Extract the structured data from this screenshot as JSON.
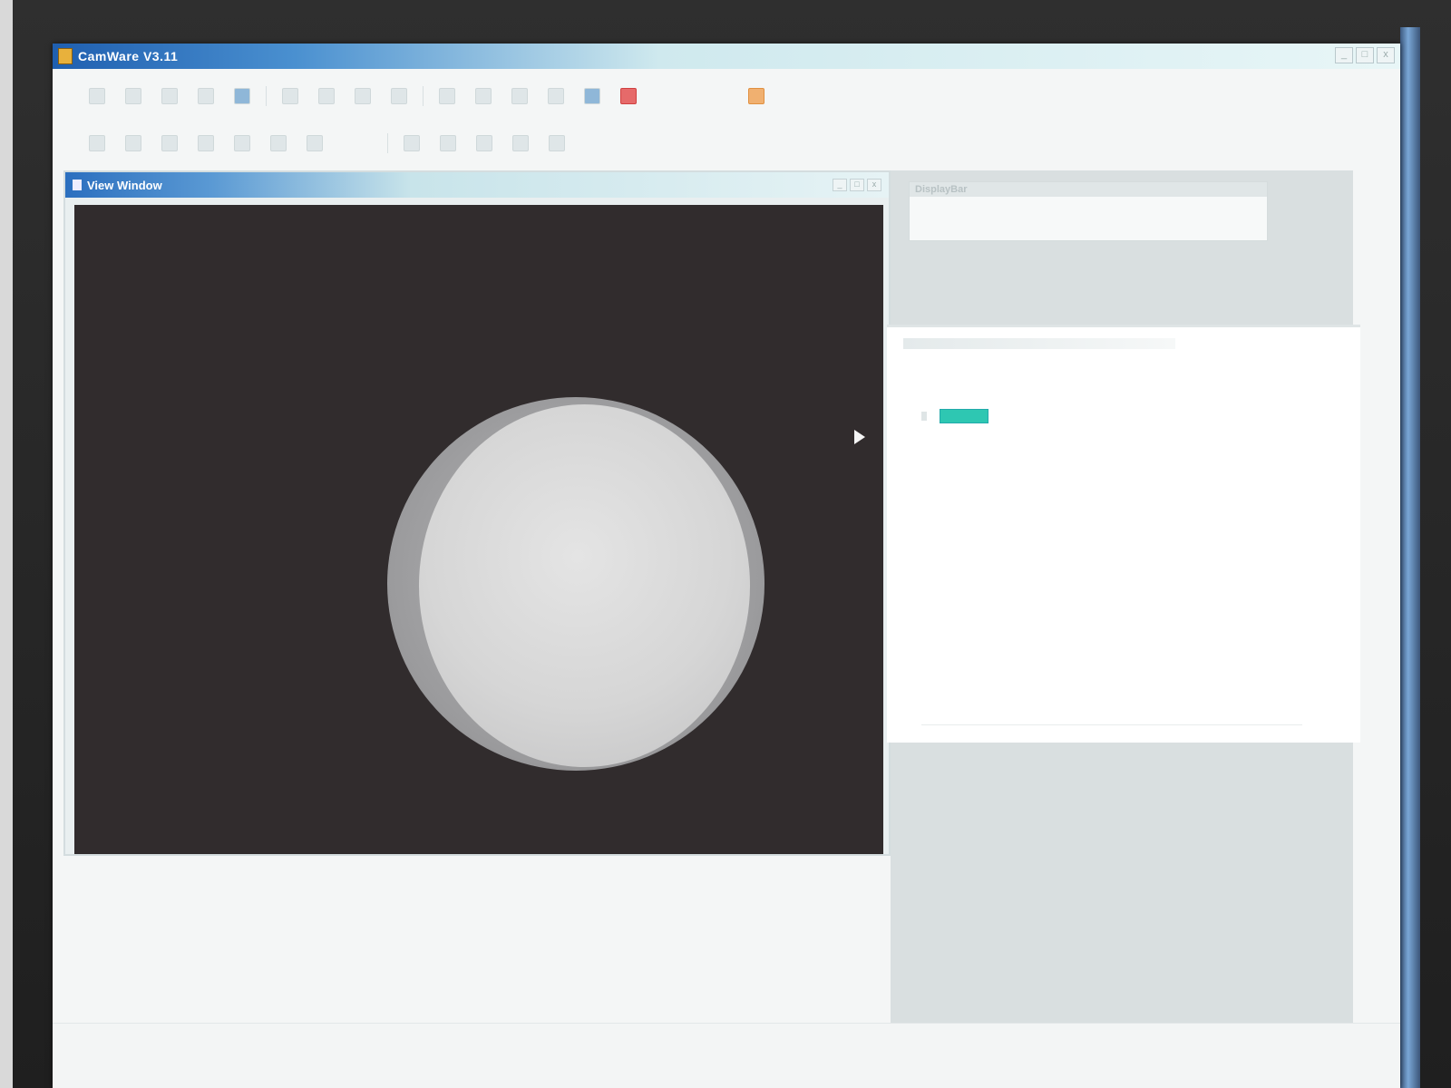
{
  "app": {
    "title": "CamWare V3.11",
    "controls": [
      "_",
      "□",
      "x"
    ]
  },
  "toolbar_top": {
    "text_fields": [
      "",
      ""
    ]
  },
  "view_window": {
    "title": "View Window",
    "controls": [
      "_",
      "□",
      "x"
    ]
  },
  "display_panel": {
    "title": "DisplayBar",
    "items": [
      "",
      "",
      "",
      "",
      ""
    ]
  },
  "properties_panel": {
    "swatch_color": "#2ec7b2",
    "rows": [
      "",
      "",
      "",
      "",
      "",
      "",
      "",
      "",
      ""
    ]
  },
  "status_bar": {
    "items": [
      "",
      "",
      "",
      ""
    ]
  },
  "colors": {
    "titlebar_start": "#1f5fb0",
    "image_background": "#312c2d",
    "disc": "#d6d6d6"
  }
}
